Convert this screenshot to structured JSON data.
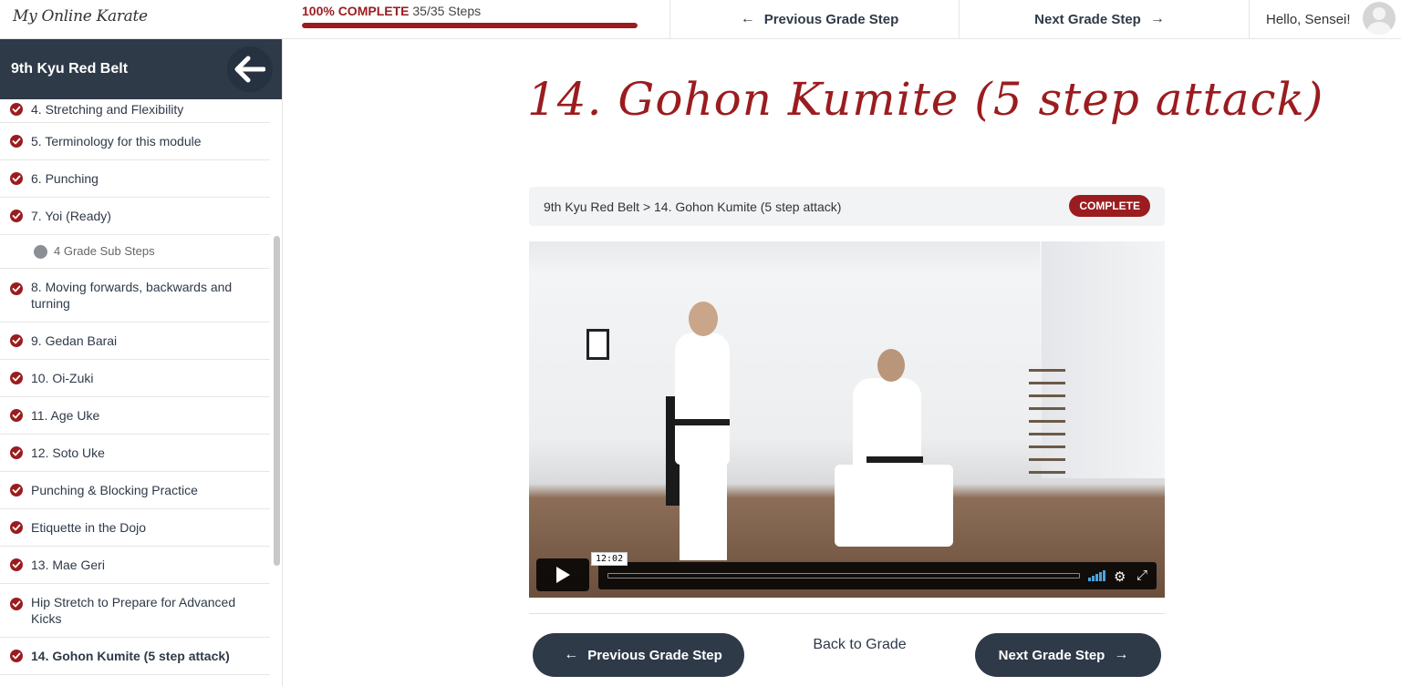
{
  "app": {
    "logo_text": "My Online Karate"
  },
  "progress": {
    "percent_label": "100% COMPLETE",
    "steps_label": "35/35 Steps",
    "fraction": 1.0
  },
  "top_nav": {
    "previous_label": "Previous Grade Step",
    "next_label": "Next Grade Step"
  },
  "user": {
    "greeting": "Hello, Sensei!"
  },
  "sidebar": {
    "grade_title": "9th Kyu Red Belt",
    "items": [
      {
        "label": "4. Stretching and Flexibility",
        "complete": true
      },
      {
        "label": "5. Terminology for this module",
        "complete": true
      },
      {
        "label": "6. Punching",
        "complete": true
      },
      {
        "label": "7. Yoi (Ready)",
        "complete": true
      },
      {
        "label": "4 Grade Sub Steps",
        "sub": true
      },
      {
        "label": "8. Moving forwards, backwards and turning",
        "complete": true
      },
      {
        "label": "9. Gedan Barai",
        "complete": true
      },
      {
        "label": "10. Oi-Zuki",
        "complete": true
      },
      {
        "label": "11. Age Uke",
        "complete": true
      },
      {
        "label": "12. Soto Uke",
        "complete": true
      },
      {
        "label": "Punching & Blocking Practice",
        "complete": true
      },
      {
        "label": "Etiquette in the Dojo",
        "complete": true
      },
      {
        "label": "13. Mae Geri",
        "complete": true
      },
      {
        "label": "Hip Stretch to Prepare for Advanced Kicks",
        "complete": true
      },
      {
        "label": "14. Gohon Kumite (5 step attack)",
        "complete": true,
        "active": true
      }
    ]
  },
  "main": {
    "title": "14. Gohon Kumite (5 step attack)",
    "breadcrumb": "9th Kyu Red Belt > 14. Gohon Kumite (5 step attack)",
    "status_badge": "COMPLETE",
    "video": {
      "duration": "12:02"
    },
    "back_to_grade": "Back to Grade",
    "prev_button": "Previous Grade Step",
    "next_button": "Next Grade Step"
  },
  "colors": {
    "accent": "#9b1c1f",
    "dark": "#2e3a48"
  }
}
